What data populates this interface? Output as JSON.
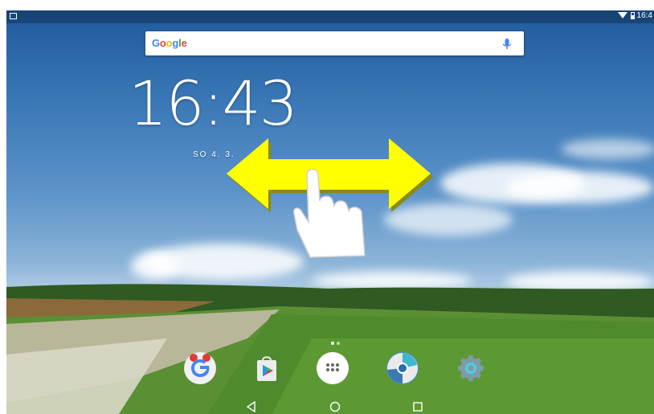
{
  "status_bar": {
    "left_icon": "screenshot-icon",
    "right_time": "16:4",
    "icons": [
      "wifi-icon",
      "battery-icon"
    ]
  },
  "search_widget": {
    "logo_text": [
      "G",
      "o",
      "o",
      "g",
      "l",
      "e"
    ],
    "logo_colors": [
      "#4285F4",
      "#EA4335",
      "#FBBC05",
      "#4285F4",
      "#34A853",
      "#EA4335"
    ],
    "mic_icon": "mic-icon",
    "mic_color": "#4285F4"
  },
  "clock_widget": {
    "time": "16:43",
    "date": "SO 4. 3."
  },
  "overlay": {
    "gesture": "swipe-horizontal-hint",
    "arrow_color": "#FFFF00",
    "icons": [
      "double-arrow-icon",
      "hand-pointer-icon"
    ]
  },
  "dock": {
    "apps": [
      {
        "name": "google-app",
        "icon": "google-icon"
      },
      {
        "name": "play-store",
        "icon": "play-store-icon"
      },
      {
        "name": "app-drawer",
        "icon": "apps-grid-icon"
      },
      {
        "name": "chrome-app",
        "icon": "chrome-icon"
      },
      {
        "name": "settings-app",
        "icon": "settings-gear-icon"
      }
    ],
    "page_indicator": {
      "pages": 2,
      "current": 1
    }
  },
  "nav_bar": {
    "buttons": [
      "back-icon",
      "home-icon",
      "recents-icon"
    ]
  }
}
